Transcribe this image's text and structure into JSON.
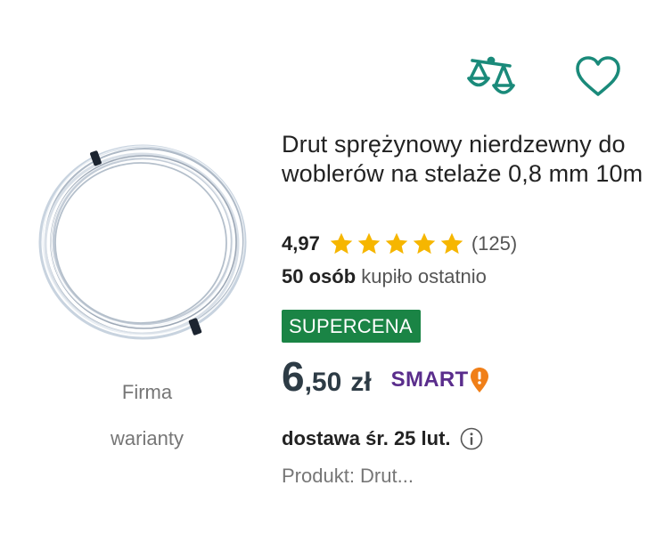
{
  "actions": {
    "compare_icon": "scales-icon",
    "favorite_icon": "heart-icon",
    "accent_color": "#1a8a7a"
  },
  "product": {
    "title": "Drut sprężynowy nierdzewny do woblerów na stelaże 0,8 mm 10m",
    "image_icon": "wire-coil-image",
    "brand_label": "Firma",
    "variants_label": "warianty",
    "rating": {
      "value": "4,97",
      "stars": 5,
      "count": "(125)",
      "star_color": "#f6b600"
    },
    "bought": {
      "count": "50 osób",
      "text": "kupiło ostatnio"
    },
    "badge": "SUPERCENA",
    "badge_color": "#1a8445",
    "price": {
      "integer": "6",
      "decimal": ",50",
      "currency": "zł"
    },
    "smart": {
      "label": "SMART",
      "color": "#5a2d8c",
      "pin_color": "#f07f18"
    },
    "delivery": "dostawa śr. 25 lut.",
    "delivery_info_icon": "info-icon",
    "product_line": "Produkt: Drut..."
  }
}
